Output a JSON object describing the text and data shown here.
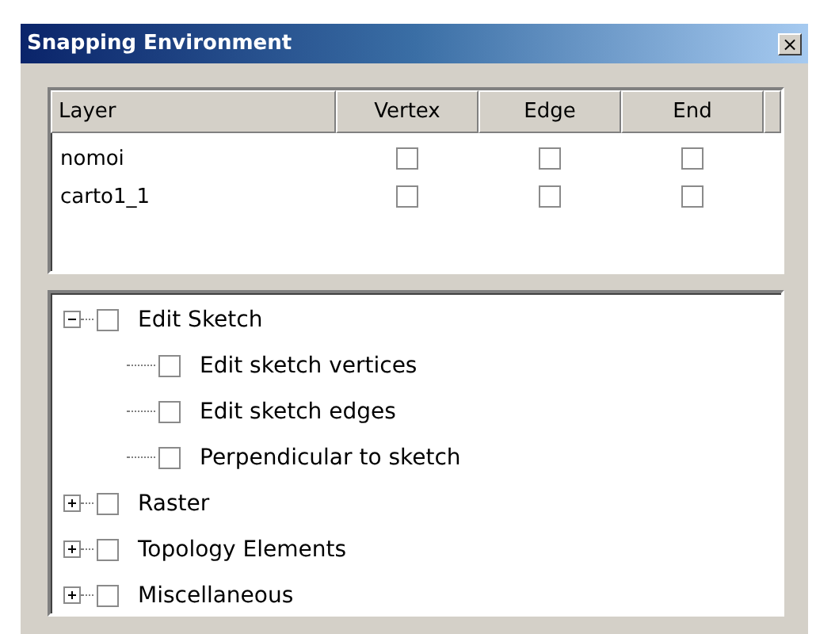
{
  "window": {
    "title": "Snapping Environment",
    "close": "×"
  },
  "table": {
    "columns": [
      "Layer",
      "Vertex",
      "Edge",
      "End"
    ],
    "rows": [
      {
        "layer": "nomoi",
        "vertex": false,
        "edge": false,
        "end": false
      },
      {
        "layer": "carto1_1",
        "vertex": false,
        "edge": false,
        "end": false
      }
    ]
  },
  "tree": [
    {
      "label": "Edit Sketch",
      "checked": false,
      "expanded": true,
      "children": [
        {
          "label": "Edit sketch vertices",
          "checked": false
        },
        {
          "label": "Edit sketch edges",
          "checked": false
        },
        {
          "label": "Perpendicular to sketch",
          "checked": false
        }
      ]
    },
    {
      "label": "Raster",
      "checked": false,
      "expanded": false
    },
    {
      "label": "Topology Elements",
      "checked": false,
      "expanded": false
    },
    {
      "label": "Miscellaneous",
      "checked": false,
      "expanded": false
    }
  ]
}
